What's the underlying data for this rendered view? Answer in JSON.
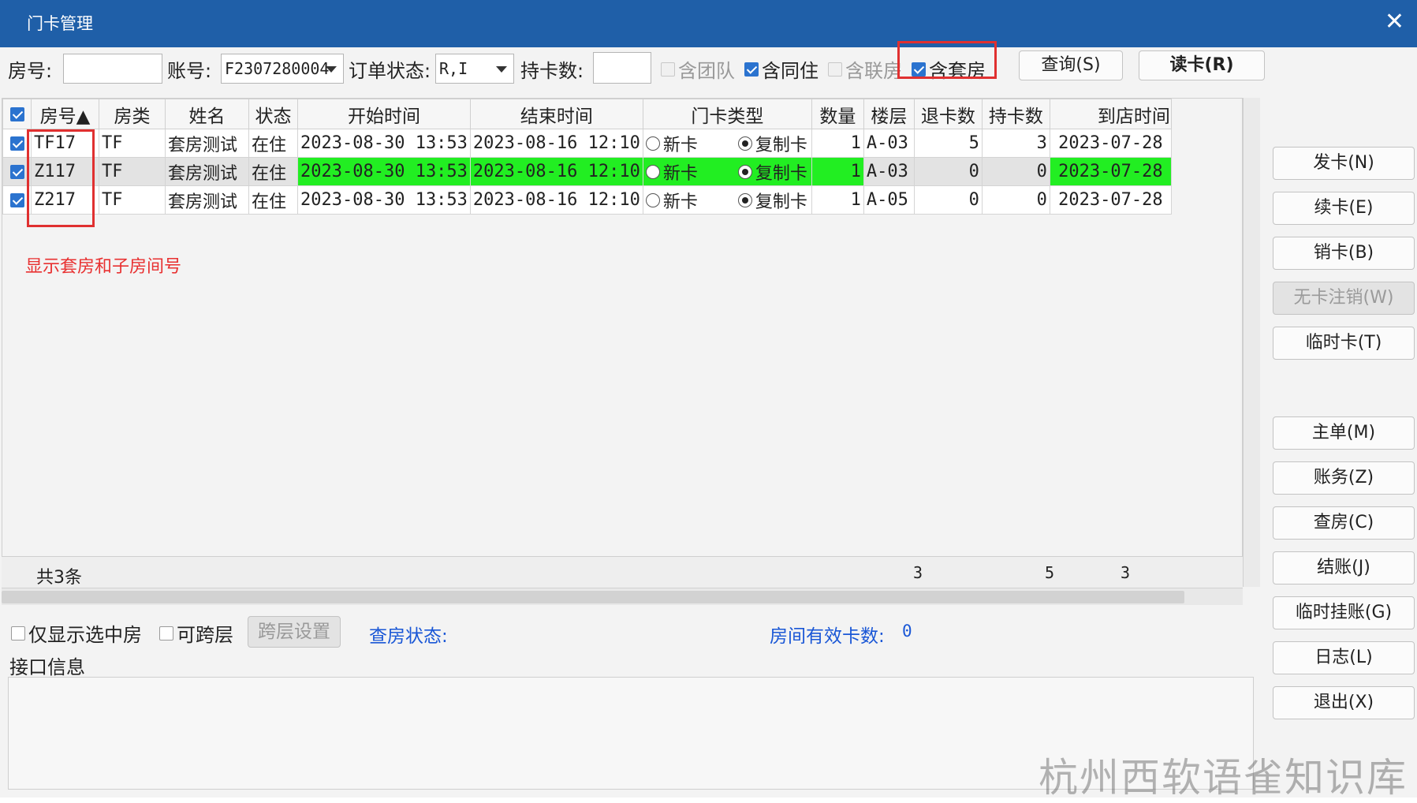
{
  "window": {
    "title": "门卡管理",
    "close_glyph": "✕"
  },
  "search": {
    "room_label": "房号:",
    "room_value": "",
    "account_label": "账号:",
    "account_value": "F2307280004",
    "order_status_label": "订单状态:",
    "order_status_value": "R,I",
    "card_count_label": "持卡数:",
    "card_count_value": "",
    "include_team": {
      "label": "含团队",
      "checked": false,
      "enabled": false
    },
    "include_shared": {
      "label": "含同住",
      "checked": true,
      "enabled": true
    },
    "include_linked": {
      "label": "含联房",
      "checked": false,
      "enabled": false
    },
    "include_suite": {
      "label": "含套房",
      "checked": true,
      "enabled": true
    },
    "query_button": "查询(S)",
    "read_card_button": "读卡(R)"
  },
  "side_buttons": {
    "issue": "发卡(N)",
    "renew": "续卡(E)",
    "cancel": "销卡(B)",
    "cancel_no_card": "无卡注销(W)",
    "temp": "临时卡(T)",
    "master": "主单(M)",
    "account": "账务(Z)",
    "inspect": "查房(C)",
    "checkout": "结账(J)",
    "temp_charge": "临时挂账(G)",
    "log": "日志(L)",
    "exit": "退出(X)"
  },
  "grid": {
    "columns": [
      "房号▲",
      "房类",
      "姓名",
      "状态",
      "开始时间",
      "结束时间",
      "门卡类型",
      "数量",
      "楼层",
      "退卡数",
      "持卡数",
      "到店时间"
    ],
    "card_type_options": [
      "新卡",
      "复制卡"
    ],
    "rows": [
      {
        "room": "TF17",
        "type": "TF",
        "name": "套房测试",
        "status": "在住",
        "start": "2023-08-30 13:53",
        "end": "2023-08-16 12:10",
        "card_type": "复制卡",
        "qty": "1",
        "floor": "A-03",
        "returned": "5",
        "held": "3",
        "arrival": "2023-07-28",
        "selected": false
      },
      {
        "room": "Z117",
        "type": "TF",
        "name": "套房测试",
        "status": "在住",
        "start": "2023-08-30 13:53",
        "end": "2023-08-16 12:10",
        "card_type": "复制卡",
        "qty": "1",
        "floor": "A-03",
        "returned": "0",
        "held": "0",
        "arrival": "2023-07-28",
        "selected": true
      },
      {
        "room": "Z217",
        "type": "TF",
        "name": "套房测试",
        "status": "在住",
        "start": "2023-08-30 13:53",
        "end": "2023-08-16 12:10",
        "card_type": "复制卡",
        "qty": "1",
        "floor": "A-05",
        "returned": "0",
        "held": "0",
        "arrival": "2023-07-28",
        "selected": false
      }
    ],
    "footer": {
      "total": "共3条",
      "qty_sum": "3",
      "returned_sum": "5",
      "held_sum": "3"
    },
    "highlight_color": "#22ee22"
  },
  "annotation": "显示套房和子房间号",
  "bottom": {
    "only_selected": {
      "label": "仅显示选中房",
      "checked": false
    },
    "cross_floor": {
      "label": "可跨层",
      "checked": false
    },
    "cross_floor_settings_button": "跨层设置",
    "inspect_status_label": "查房状态:",
    "valid_cards_label": "房间有效卡数:",
    "valid_cards_value": "0"
  },
  "interface_panel": {
    "title": "接口信息"
  },
  "watermark": "杭州西软语雀知识库",
  "colors": {
    "titlebar": "#1f5fa8",
    "accent_red": "#e03030",
    "link_blue": "#1a57d6",
    "check_blue": "#2b73cf"
  }
}
